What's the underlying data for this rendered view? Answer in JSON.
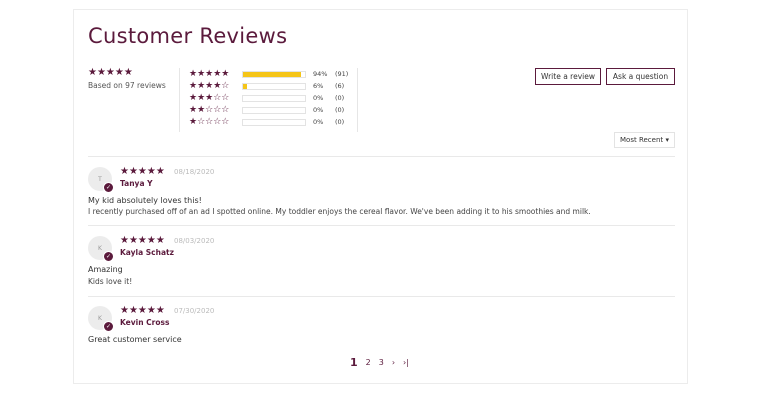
{
  "header": {
    "title": "Customer Reviews"
  },
  "summary": {
    "stars": "★★★★★",
    "based_on": "Based on 97 reviews"
  },
  "histogram": [
    {
      "stars": "★★★★★",
      "percent": "94%",
      "count": "(91)",
      "fill": 0.94
    },
    {
      "stars": "★★★★☆",
      "percent": "6%",
      "count": "(6)",
      "fill": 0.06
    },
    {
      "stars": "★★★☆☆",
      "percent": "0%",
      "count": "(0)",
      "fill": 0
    },
    {
      "stars": "★★☆☆☆",
      "percent": "0%",
      "count": "(0)",
      "fill": 0
    },
    {
      "stars": "★☆☆☆☆",
      "percent": "0%",
      "count": "(0)",
      "fill": 0
    }
  ],
  "actions": {
    "write_review": "Write a review",
    "ask_question": "Ask a question"
  },
  "sort": {
    "selected": "Most Recent",
    "caret": "▾"
  },
  "reviews": [
    {
      "initial": "T",
      "stars": "★★★★★",
      "date": "08/18/2020",
      "name": "Tanya Y",
      "title": "My kid absolutely loves this!",
      "body": "I recently purchased off of an ad I spotted online. My toddler enjoys the cereal flavor. We've been adding it to his smoothies and milk."
    },
    {
      "initial": "K",
      "stars": "★★★★★",
      "date": "08/03/2020",
      "name": "Kayla Schatz",
      "title": "Amazing",
      "body": "Kids love it!"
    },
    {
      "initial": "K",
      "stars": "★★★★★",
      "date": "07/30/2020",
      "name": "Kevin Cross",
      "title": "Great customer service",
      "body": ""
    }
  ],
  "pagination": {
    "current": "1",
    "p2": "2",
    "p3": "3",
    "next": "›",
    "last": "›|"
  },
  "colors": {
    "accent": "#5b1a3c",
    "bar": "#f5c518"
  }
}
